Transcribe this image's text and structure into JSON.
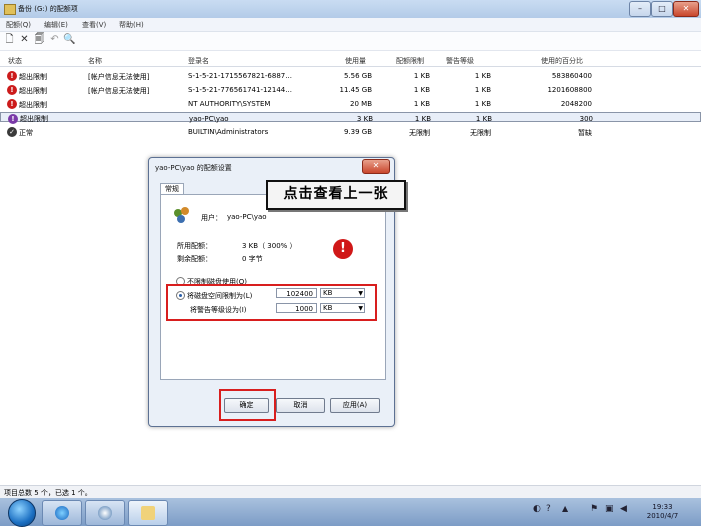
{
  "window": {
    "title": "备份 (G:) 的配额项"
  },
  "menu": [
    "配额(Q)",
    "编辑(E)",
    "查看(V)",
    "帮助(H)"
  ],
  "columns": [
    "状态",
    "名称",
    "登录名",
    "使用量",
    "配额限制",
    "警告等级",
    "使用的百分比"
  ],
  "rows": [
    {
      "status": "超出限制",
      "name": "[帐户信息无法使用]",
      "login": "S-1-5-21-1715567821-6887...",
      "used": "5.56 GB",
      "limit": "1 KB",
      "warn": "1 KB",
      "pct": "583860400"
    },
    {
      "status": "超出限制",
      "name": "[帐户信息无法使用]",
      "login": "S-1-5-21-776561741-12144...",
      "used": "11.45 GB",
      "limit": "1 KB",
      "warn": "1 KB",
      "pct": "1201608800"
    },
    {
      "status": "超出限制",
      "name": "",
      "login": "NT AUTHORITY\\SYSTEM",
      "used": "20 MB",
      "limit": "1 KB",
      "warn": "1 KB",
      "pct": "2048200"
    },
    {
      "status": "超出限制",
      "name": "",
      "login": "yao-PC\\yao",
      "used": "3 KB",
      "limit": "1 KB",
      "warn": "1 KB",
      "pct": "300"
    },
    {
      "status": "正常",
      "name": "",
      "login": "BUILTIN\\Administrators",
      "used": "9.39 GB",
      "limit": "无限制",
      "warn": "无限制",
      "pct": "暂缺"
    }
  ],
  "statusbar": "项目总数 5 个，已选 1 个。",
  "clock": {
    "time": "19:33",
    "date": "2010/4/7"
  },
  "dialog": {
    "title": "yao-PC\\yao 的配额设置",
    "tab": "常规",
    "user_label": "用户：",
    "user_value": "yao-PC\\yao",
    "used_label": "所用配额：",
    "used_value": "3 KB（ 300% ）",
    "remaining_label": "剩余配额：",
    "remaining_value": "0 字节",
    "no_limit_label": "不限制磁盘使用(O)",
    "limit_label": "将磁盘空间限制为(L)",
    "limit_value": "102400",
    "limit_unit": "KB",
    "warn_label": "将警告等级设为(I)",
    "warn_value": "1000",
    "warn_unit": "KB",
    "ok": "确定",
    "cancel": "取消",
    "apply": "应用(A)"
  },
  "callout": "点击查看上一张"
}
